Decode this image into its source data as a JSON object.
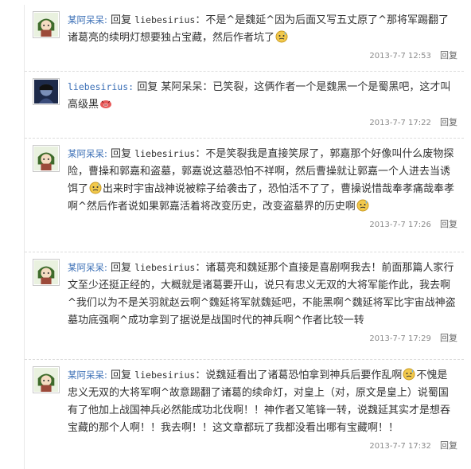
{
  "comments": [
    {
      "author": "某阿呆呆:",
      "prefix": "回复",
      "reply_to": "liebesirius",
      "body_parts": [
        "：不是^是魏延^因为后面又写五丈原了^那将军踢翻了诸葛亮的续明灯想要独占宝藏，然后作者坑了"
      ],
      "date": "2013-7-7 12:53",
      "reply_label": "回复"
    },
    {
      "author": "liebesirius:",
      "prefix": "回复",
      "reply_to": "某阿呆呆",
      "body_parts": [
        "：已笑裂，这俩作者一个是魏黑一个是蜀黑吧，这才叫高级黑"
      ],
      "date": "2013-7-7 17:22",
      "reply_label": "回复"
    },
    {
      "author": "某阿呆呆:",
      "prefix": "回复",
      "reply_to": "liebesirius",
      "body_parts": [
        "：不是笑裂我是直接笑尿了，郭嘉那个好像叫什么废物探险，曹操和郭嘉和盗墓，郭嘉说这墓恐怕不祥啊，然后曹操就让郭嘉一个人进去当诱饵了",
        "出来时宇宙战神说被粽子给袭击了，恐怕活不了了，曹操说惜哉奉孝痛哉奉孝啊^然后作者说如果郭嘉活着将改变历史，改变盗墓界的历史啊"
      ],
      "date": "2013-7-7 17:26",
      "reply_label": "回复"
    },
    {
      "author": "某阿呆呆:",
      "prefix": "回复",
      "reply_to": "liebesirius",
      "body_parts": [
        "：诸葛亮和魏延那个直接是喜剧啊我去！前面那篇人家行文至少还挺正经的，大概就是诸葛要开山，说只有忠义无双的大将军能作此，我去啊^我们以为不是关羽就赵云啊^魏延将军就魏延吧，不能黑啊^魏延将军比宇宙战神盗墓功底强啊^成功拿到了据说是战国时代的神兵啊^作者比较一转"
      ],
      "date": "2013-7-7 17:29",
      "reply_label": "回复"
    },
    {
      "author": "某阿呆呆:",
      "prefix": "回复",
      "reply_to": "liebesirius",
      "body_parts": [
        "：说魏延看出了诸葛恐怕拿到神兵后要作乱啊",
        "不愧是忠义无双的大将军啊^故意踢翻了诸葛的续命灯，对皇上（对，原文是皇上）说蜀国有了他加上战国神兵必然能成功北伐啊！！神作者又笔锋一转，说魏延其实才是想吞宝藏的那个人啊！！我去啊！！这文章都玩了我都没看出哪有宝藏啊！！"
      ],
      "date": "2013-7-7 17:32",
      "reply_label": "回复"
    }
  ],
  "colors": {
    "username": "#3b6fb6",
    "meta": "#8a8a8a",
    "emoji": "#f2c94c"
  },
  "icons": [
    "avatar-anime-icon",
    "avatar-dark-icon",
    "sweat-face-icon",
    "pig-face-icon"
  ]
}
